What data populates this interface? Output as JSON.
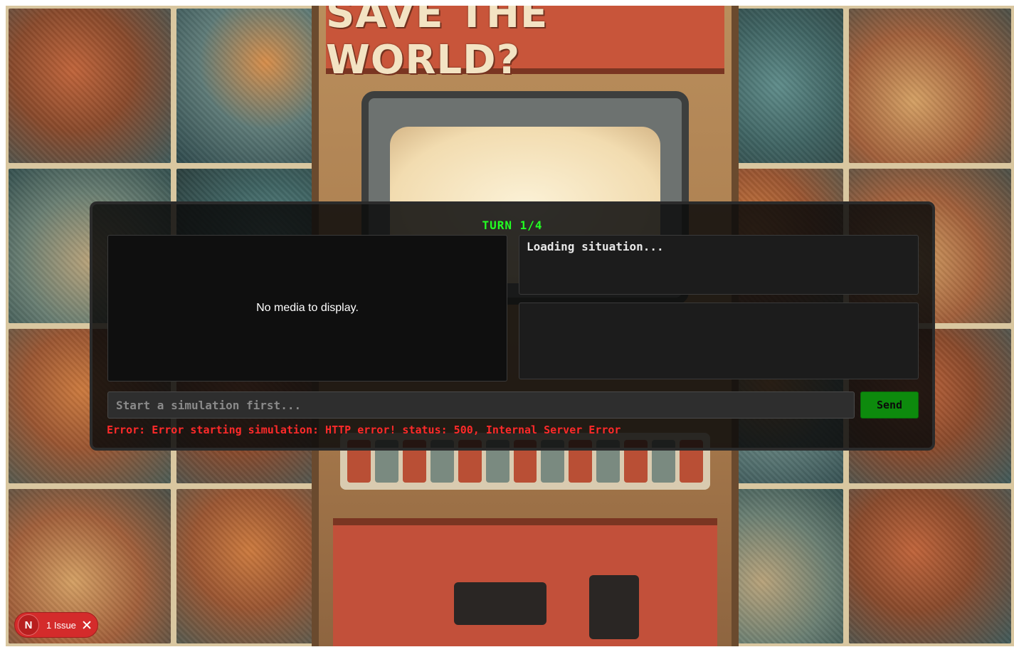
{
  "background": {
    "marquee_text": "SAVE THE WORLD?"
  },
  "game": {
    "turn_label": "TURN 1/4",
    "media_message": "No media to display.",
    "situation_text": "Loading situation...",
    "response_text": "",
    "input_placeholder": "Start a simulation first...",
    "input_value": "",
    "send_label": "Send",
    "error_message": "Error: Error starting simulation: HTTP error! status: 500, Internal Server Error"
  },
  "issue_badge": {
    "logo_letter": "N",
    "label": "1 Issue",
    "close_icon": "close-icon"
  },
  "colors": {
    "turn": "#22ff22",
    "send_button": "#0d8a0d",
    "error": "#ff2a2a",
    "issue_badge": "#d42b2b"
  }
}
